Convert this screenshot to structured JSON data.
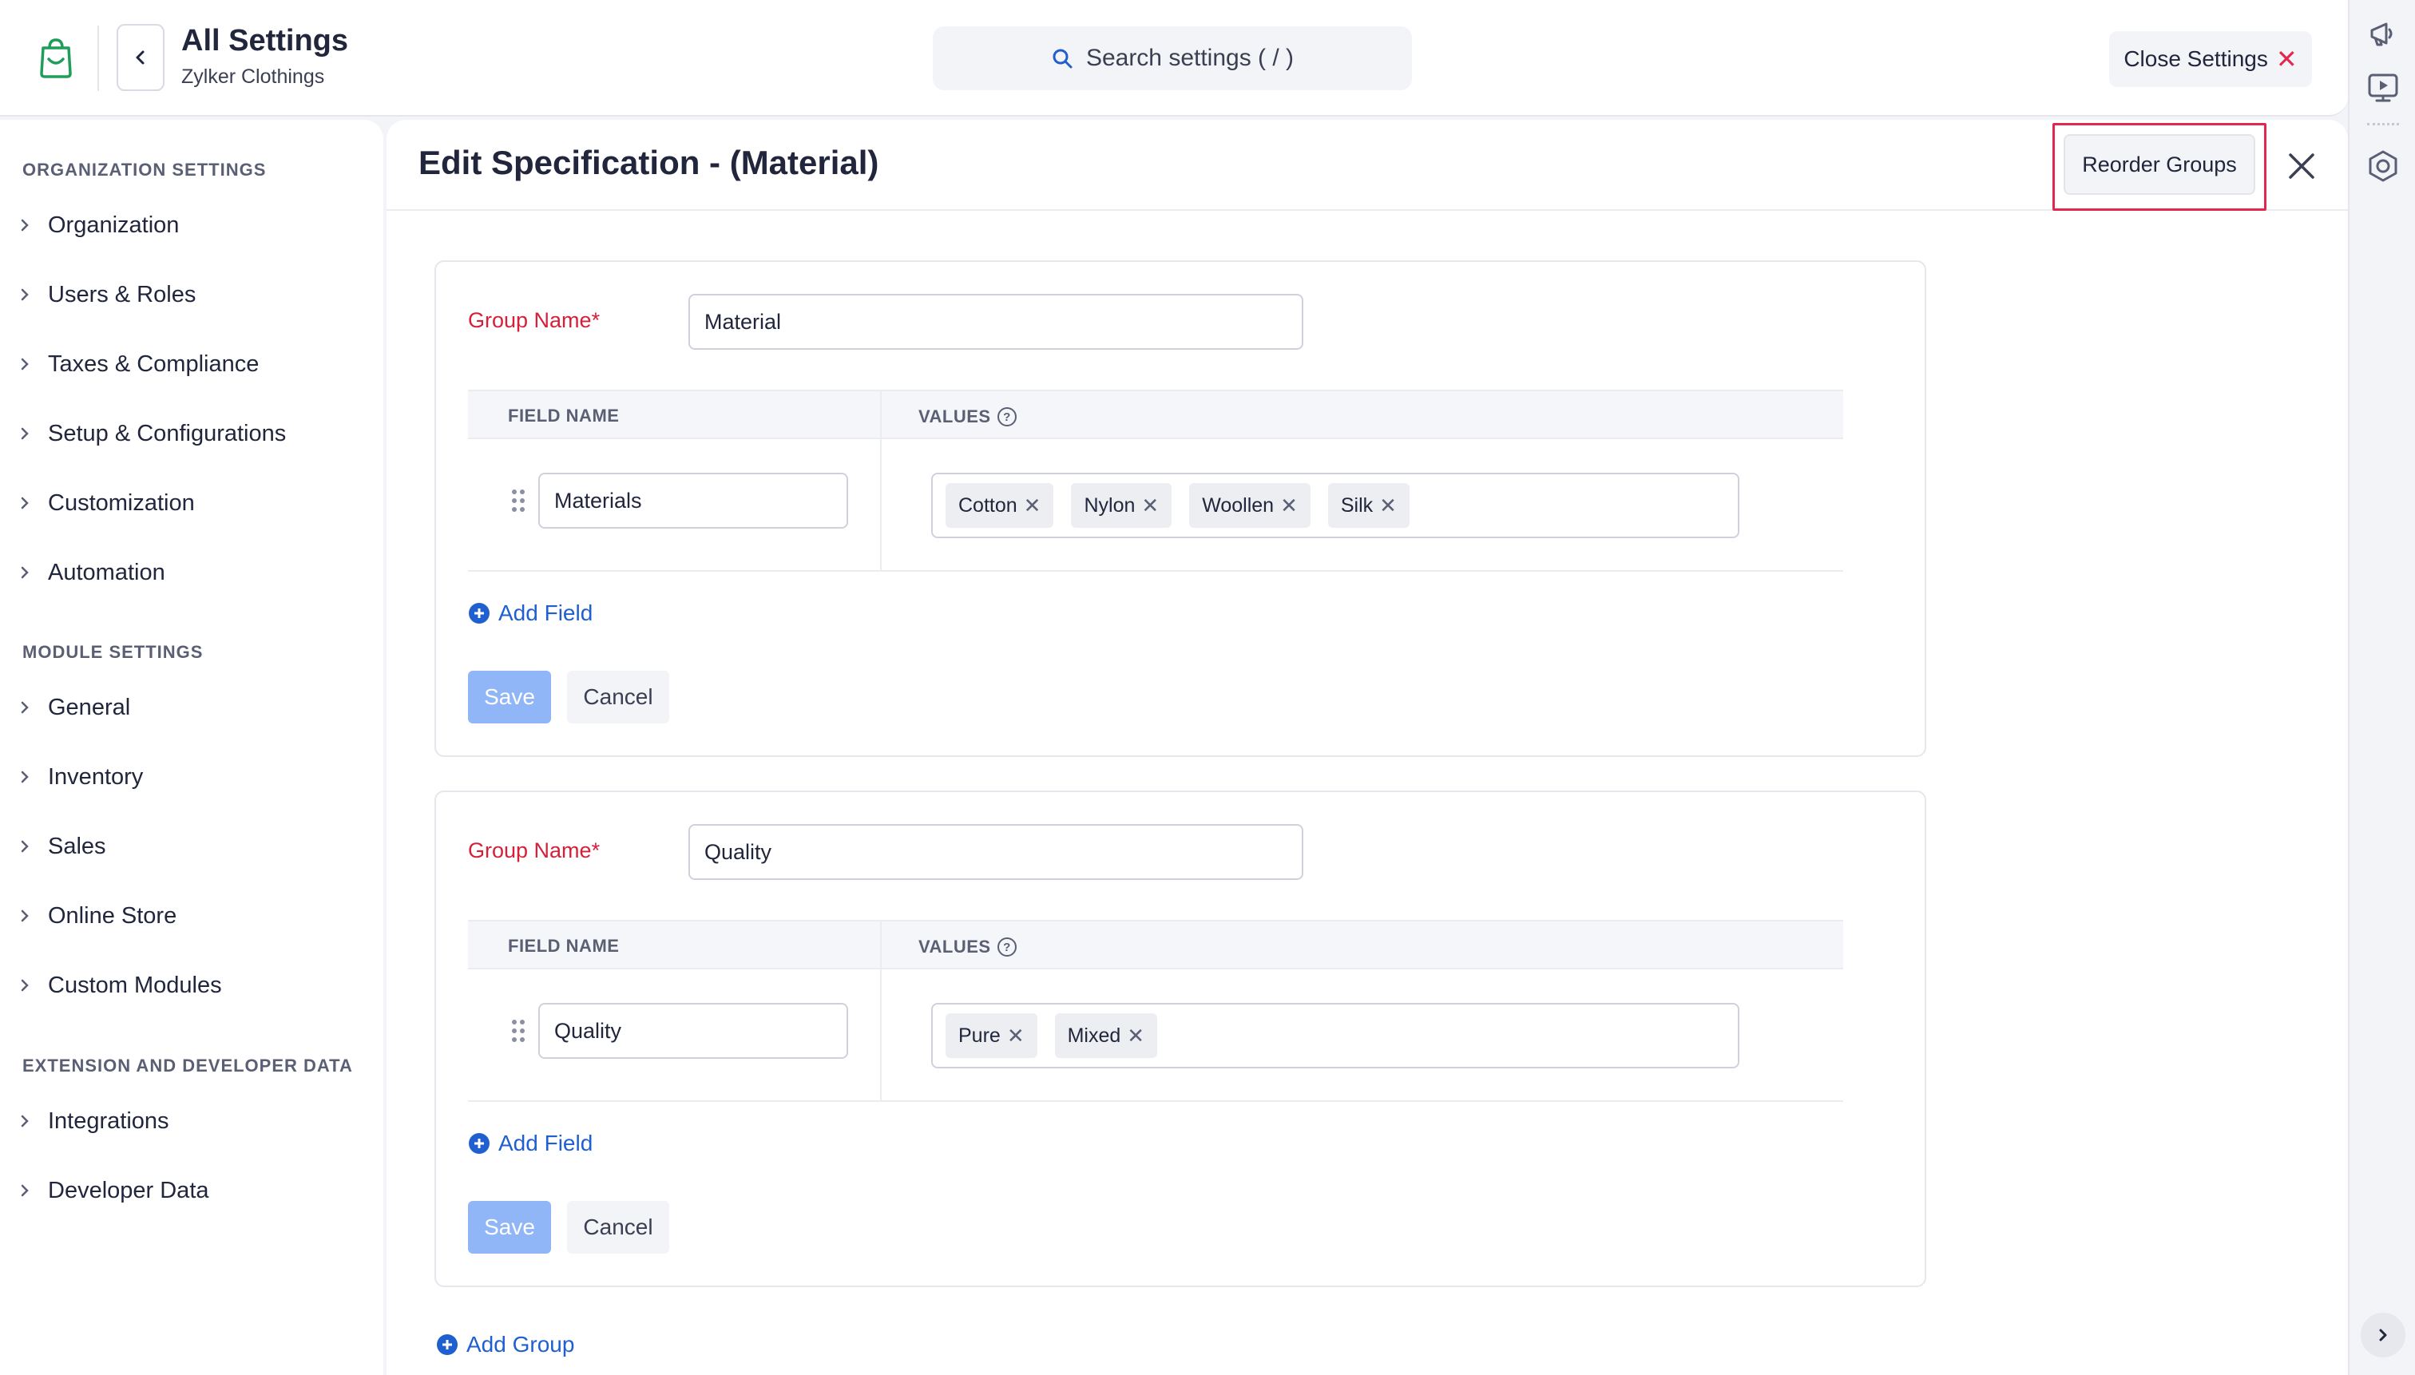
{
  "header": {
    "title": "All Settings",
    "subtitle": "Zylker Clothings",
    "search_placeholder": "Search settings ( / )",
    "close_label": "Close Settings",
    "close_glyph": "✕"
  },
  "sidebar": {
    "sections": [
      {
        "title": "ORGANIZATION SETTINGS",
        "items": [
          "Organization",
          "Users & Roles",
          "Taxes & Compliance",
          "Setup & Configurations",
          "Customization",
          "Automation"
        ]
      },
      {
        "title": "MODULE SETTINGS",
        "items": [
          "General",
          "Inventory",
          "Sales",
          "Online Store",
          "Custom Modules"
        ]
      },
      {
        "title": "EXTENSION AND DEVELOPER DATA",
        "items": [
          "Integrations",
          "Developer Data"
        ]
      }
    ]
  },
  "main": {
    "title": "Edit Specification - (Material)",
    "reorder_label": "Reorder Groups",
    "add_group_label": "Add Group",
    "groups": [
      {
        "label": "Group Name*",
        "name": "Material",
        "col_field": "FIELD NAME",
        "col_values": "VALUES",
        "field_name": "Materials",
        "values": [
          "Cotton",
          "Nylon",
          "Woollen",
          "Silk"
        ],
        "add_field_label": "Add Field",
        "save_label": "Save",
        "cancel_label": "Cancel"
      },
      {
        "label": "Group Name*",
        "name": "Quality",
        "col_field": "FIELD NAME",
        "col_values": "VALUES",
        "field_name": "Quality",
        "values": [
          "Pure",
          "Mixed"
        ],
        "add_field_label": "Add Field",
        "save_label": "Save",
        "cancel_label": "Cancel"
      }
    ]
  },
  "colors": {
    "accent_blue": "#1f5fcf",
    "required_red": "#d42039",
    "highlight_red": "#e1294f",
    "save_disabled": "#90b6f7",
    "brand_green": "#1e9e5a"
  },
  "icons": [
    "shopping-bag-icon",
    "chevron-left-icon",
    "search-icon",
    "close-icon",
    "chevron-right-icon",
    "drag-handle-icon",
    "help-circle-icon",
    "plus-circle-icon",
    "megaphone-icon",
    "video-play-icon",
    "help-center-icon"
  ]
}
